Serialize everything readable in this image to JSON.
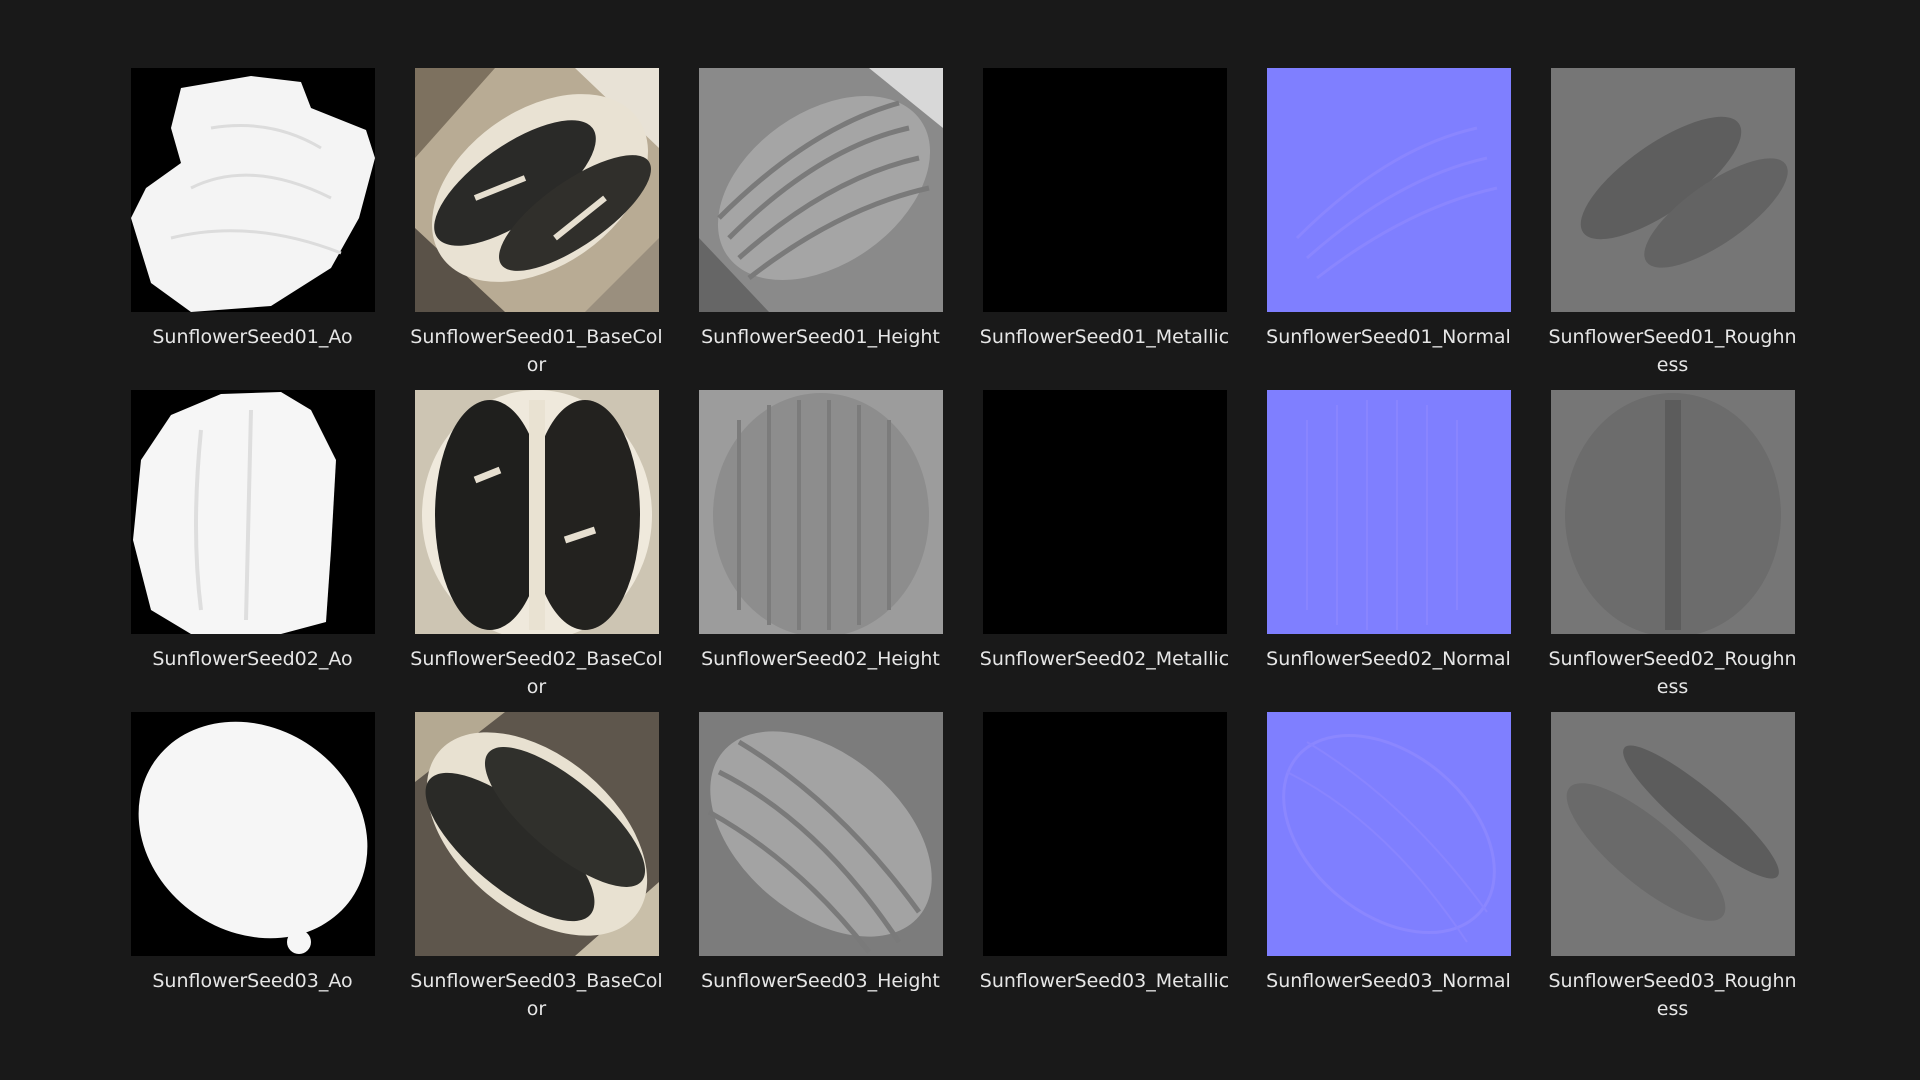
{
  "files": [
    {
      "name": "SunflowerSeed01_Ao",
      "map": "ao",
      "variant": "01"
    },
    {
      "name": "SunflowerSeed01_BaseColor",
      "map": "basecolor",
      "variant": "01"
    },
    {
      "name": "SunflowerSeed01_Height",
      "map": "height",
      "variant": "01"
    },
    {
      "name": "SunflowerSeed01_Metallic",
      "map": "metallic",
      "variant": "01"
    },
    {
      "name": "SunflowerSeed01_Normal",
      "map": "normal",
      "variant": "01"
    },
    {
      "name": "SunflowerSeed01_Roughness",
      "map": "roughness",
      "variant": "01"
    },
    {
      "name": "SunflowerSeed02_Ao",
      "map": "ao",
      "variant": "02"
    },
    {
      "name": "SunflowerSeed02_BaseColor",
      "map": "basecolor",
      "variant": "02"
    },
    {
      "name": "SunflowerSeed02_Height",
      "map": "height",
      "variant": "02"
    },
    {
      "name": "SunflowerSeed02_Metallic",
      "map": "metallic",
      "variant": "02"
    },
    {
      "name": "SunflowerSeed02_Normal",
      "map": "normal",
      "variant": "02"
    },
    {
      "name": "SunflowerSeed02_Roughness",
      "map": "roughness",
      "variant": "02"
    },
    {
      "name": "SunflowerSeed03_Ao",
      "map": "ao",
      "variant": "03"
    },
    {
      "name": "SunflowerSeed03_BaseColor",
      "map": "basecolor",
      "variant": "03"
    },
    {
      "name": "SunflowerSeed03_Height",
      "map": "height",
      "variant": "03"
    },
    {
      "name": "SunflowerSeed03_Metallic",
      "map": "metallic",
      "variant": "03"
    },
    {
      "name": "SunflowerSeed03_Normal",
      "map": "normal",
      "variant": "03"
    },
    {
      "name": "SunflowerSeed03_Roughness",
      "map": "roughness",
      "variant": "03"
    }
  ],
  "colors": {
    "background": "#191919",
    "label": "#e6e6e6",
    "normal": "#7f7fff",
    "roughness": "#767676",
    "metallic": "#000000"
  }
}
